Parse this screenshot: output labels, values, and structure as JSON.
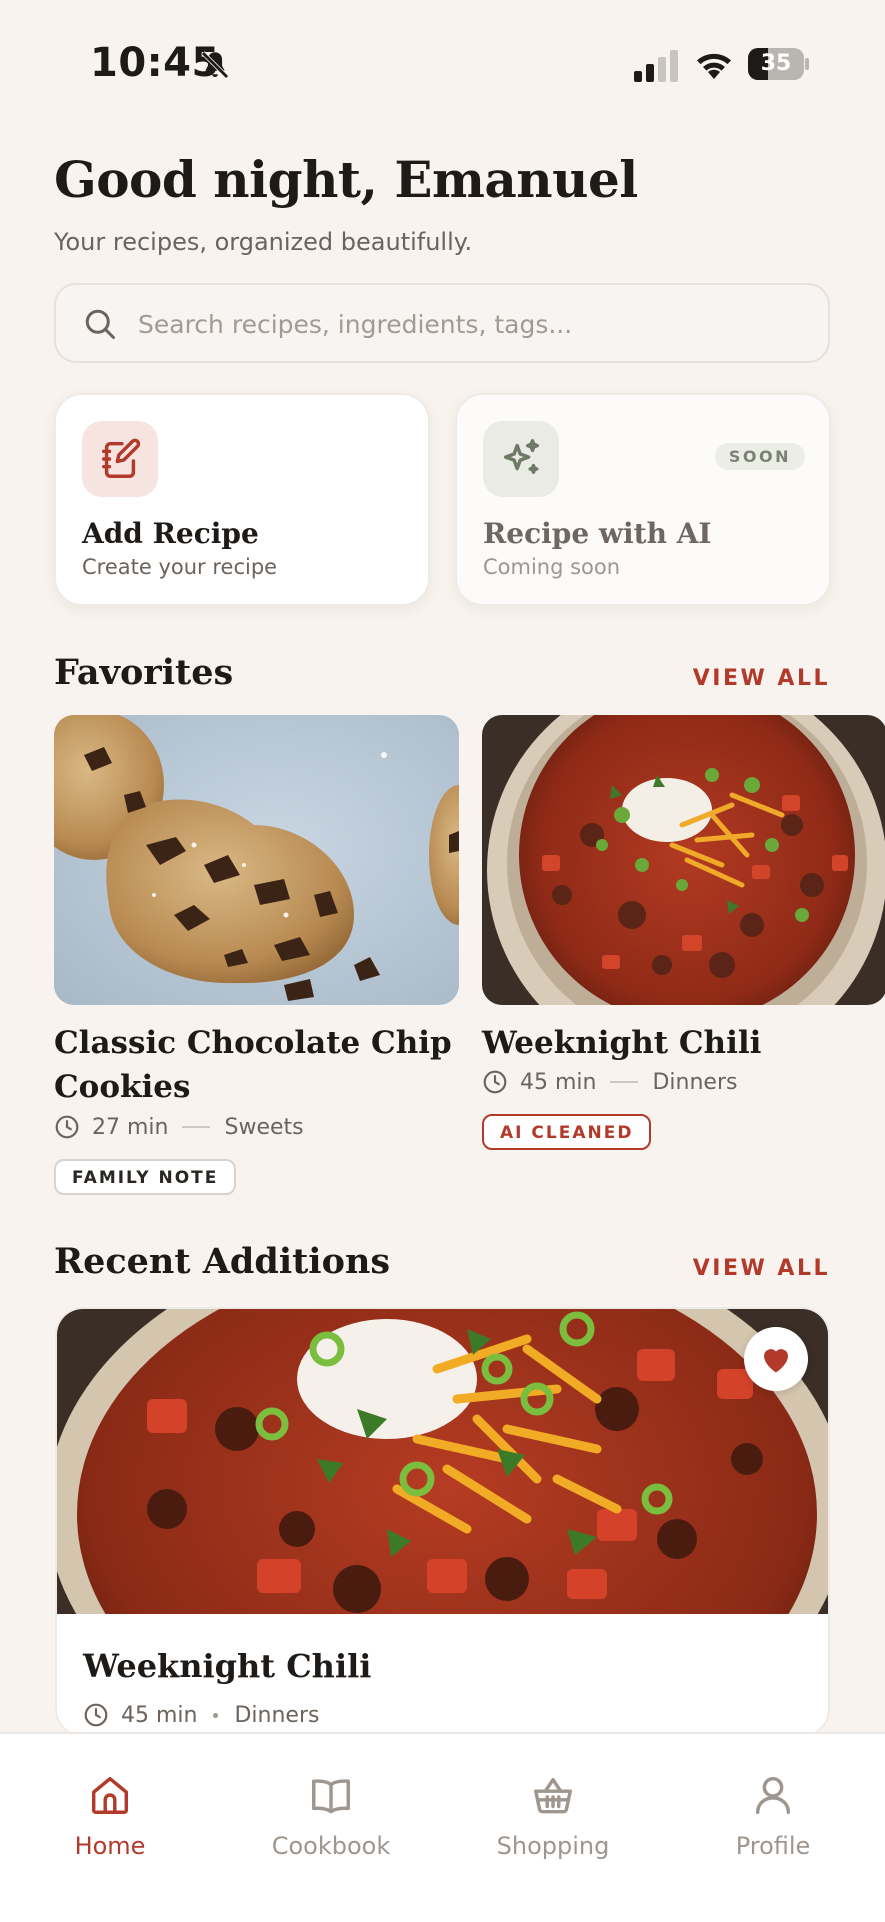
{
  "status_bar": {
    "time": "10:45",
    "battery": "35",
    "battery_level": 0.35
  },
  "header": {
    "greeting": "Good night, Emanuel",
    "subtitle": "Your recipes, organized beautifully."
  },
  "search": {
    "placeholder": "Search recipes, ingredients, tags...",
    "value": ""
  },
  "actions": {
    "add": {
      "title": "Add Recipe",
      "subtitle": "Create your recipe",
      "icon": "notebook-edit-icon"
    },
    "ai": {
      "title": "Recipe with AI",
      "subtitle": "Coming soon",
      "badge": "SOON",
      "icon": "sparkles-icon"
    }
  },
  "favorites": {
    "title": "Favorites",
    "view_all": "VIEW ALL",
    "items": [
      {
        "title": "Classic Chocolate Chip Cookies",
        "time": "27 min",
        "category": "Sweets",
        "tag": "FAMILY NOTE"
      },
      {
        "title": "Weeknight Chili",
        "time": "45 min",
        "category": "Dinners",
        "tag": "AI CLEANED"
      }
    ]
  },
  "recent": {
    "title": "Recent Additions",
    "view_all": "VIEW ALL",
    "items": [
      {
        "title": "Weeknight Chili",
        "time": "45 min",
        "category": "Dinners",
        "favorited": true
      }
    ]
  },
  "tabs": [
    {
      "label": "Home",
      "icon": "home-icon",
      "active": true
    },
    {
      "label": "Cookbook",
      "icon": "book-icon",
      "active": false
    },
    {
      "label": "Shopping",
      "icon": "basket-icon",
      "active": false
    },
    {
      "label": "Profile",
      "icon": "person-icon",
      "active": false
    }
  ],
  "colors": {
    "accent": "#b23a2a",
    "background": "#f8f3ee",
    "muted": "#9e968f"
  }
}
